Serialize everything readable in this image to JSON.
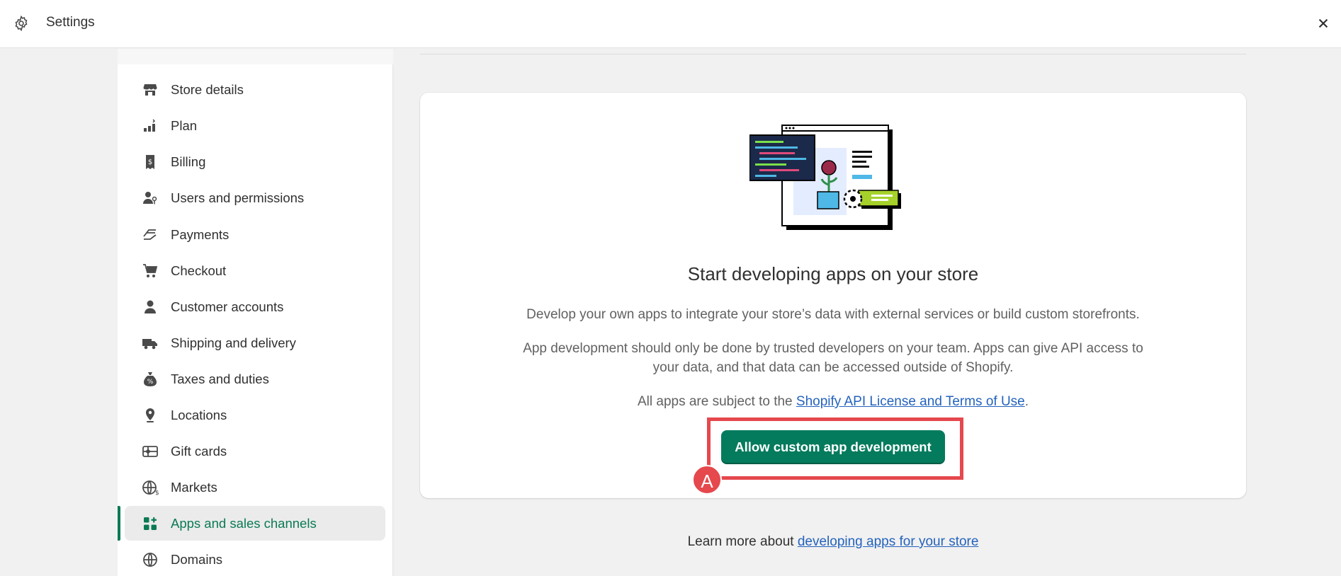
{
  "topbar": {
    "title": "Settings",
    "settings_icon": "gear-icon",
    "close_icon": "close-icon"
  },
  "sidebar": {
    "items": [
      {
        "label": "Store details",
        "icon": "store-icon"
      },
      {
        "label": "Plan",
        "icon": "plan-icon"
      },
      {
        "label": "Billing",
        "icon": "billing-icon"
      },
      {
        "label": "Users and permissions",
        "icon": "users-icon"
      },
      {
        "label": "Payments",
        "icon": "payments-icon"
      },
      {
        "label": "Checkout",
        "icon": "cart-icon"
      },
      {
        "label": "Customer accounts",
        "icon": "person-icon"
      },
      {
        "label": "Shipping and delivery",
        "icon": "truck-icon"
      },
      {
        "label": "Taxes and duties",
        "icon": "tax-bag-icon"
      },
      {
        "label": "Locations",
        "icon": "location-pin-icon"
      },
      {
        "label": "Gift cards",
        "icon": "gift-card-icon"
      },
      {
        "label": "Markets",
        "icon": "globe-currency-icon"
      },
      {
        "label": "Apps and sales channels",
        "icon": "apps-icon",
        "active": true
      },
      {
        "label": "Domains",
        "icon": "globe-icon"
      }
    ]
  },
  "card": {
    "title": "Start developing apps on your store",
    "paragraph1": "Develop your own apps to integrate your store’s data with external services or build custom storefronts.",
    "paragraph2": "App development should only be done by trusted developers on your team. Apps can give API access to your data, and that data can be accessed outside of Shopify.",
    "paragraph3_prefix": "All apps are subject to the ",
    "paragraph3_link": "Shopify API License and Terms of Use",
    "paragraph3_suffix": ".",
    "button_label": "Allow custom app development",
    "illustration_icon": "app-development-illustration"
  },
  "annotation": {
    "marker_label": "A",
    "color": "#e5484d"
  },
  "footer": {
    "prefix": "Learn more about ",
    "link": "developing apps for your store"
  },
  "colors": {
    "accent": "#047b5d",
    "active_text": "#0a7a55",
    "link": "#2463bc"
  }
}
